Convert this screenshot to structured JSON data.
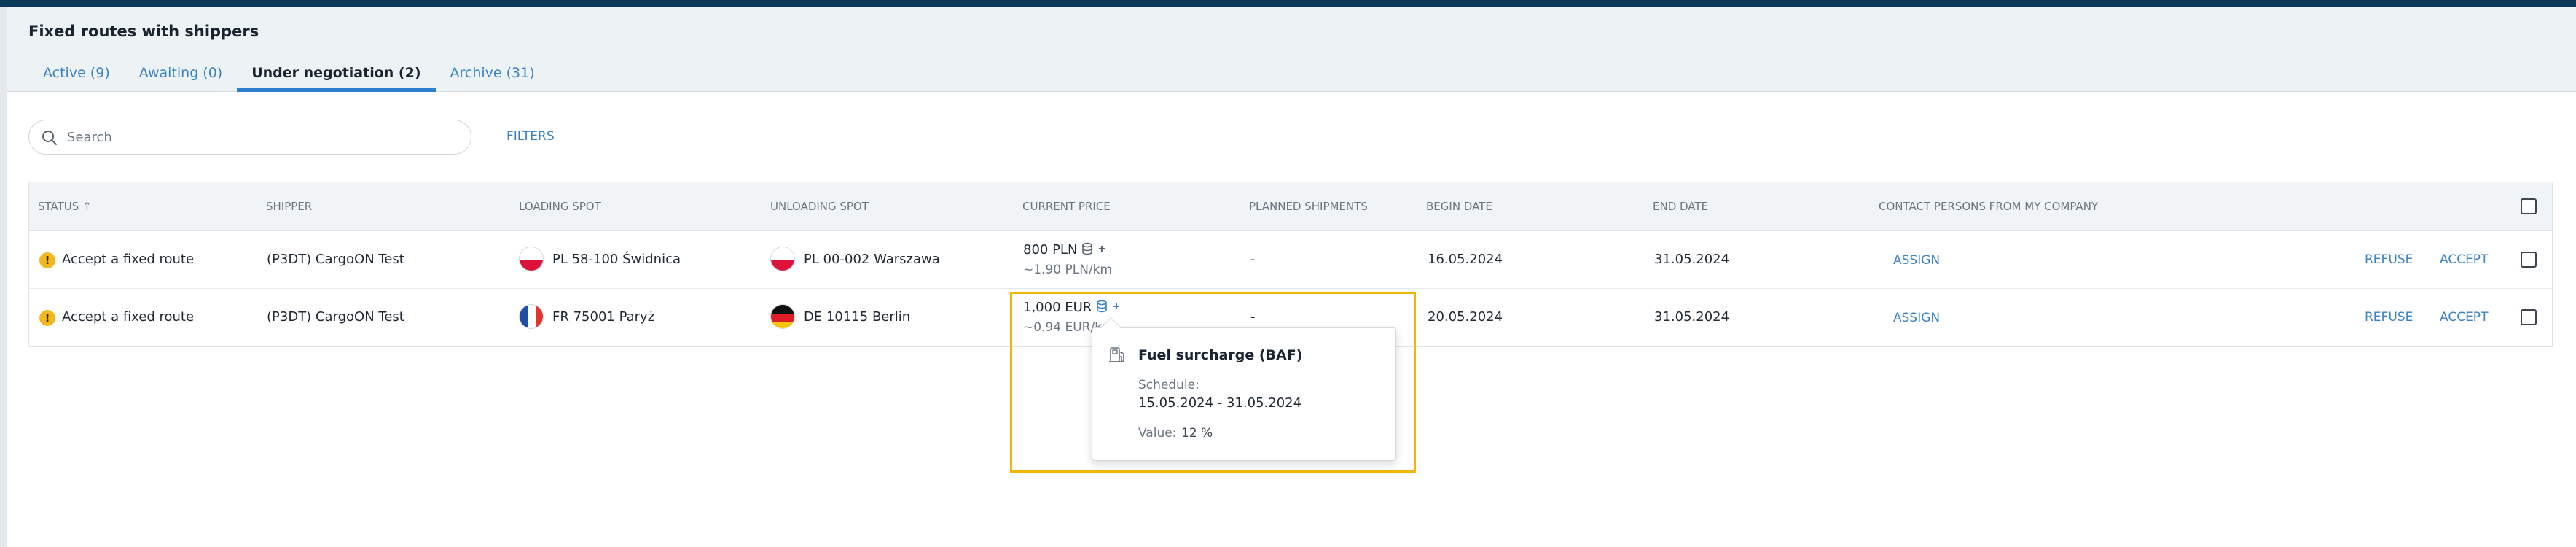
{
  "page": {
    "title": "Fixed routes with shippers"
  },
  "tabs": [
    {
      "label": "Active (9)",
      "active": false
    },
    {
      "label": "Awaiting (0)",
      "active": false
    },
    {
      "label": "Under negotiation (2)",
      "active": true
    },
    {
      "label": "Archive (31)",
      "active": false
    }
  ],
  "search": {
    "placeholder": "Search",
    "value": ""
  },
  "filters_label": "FILTERS",
  "table": {
    "headers": {
      "status": "STATUS",
      "shipper": "SHIPPER",
      "loading": "LOADING SPOT",
      "unloading": "UNLOADING SPOT",
      "price": "CURRENT PRICE",
      "planned": "PLANNED SHIPMENTS",
      "begin": "BEGIN DATE",
      "end": "END DATE",
      "contacts": "CONTACT PERSONS FROM MY COMPANY"
    },
    "rows": [
      {
        "status": "Accept a fixed route",
        "shipper": "(P3DT) CargoON Test",
        "loading_flag": "pl",
        "loading": "PL 58-100 Świdnica",
        "unloading_flag": "pl",
        "unloading": "PL 00-002 Warszawa",
        "price": "800 PLN",
        "price_sub": "~1.90 PLN/km",
        "planned": "-",
        "begin": "16.05.2024",
        "end": "31.05.2024",
        "assign": "ASSIGN",
        "refuse": "REFUSE",
        "accept": "ACCEPT"
      },
      {
        "status": "Accept a fixed route",
        "shipper": "(P3DT) CargoON Test",
        "loading_flag": "fr",
        "loading": "FR 75001 Paryż",
        "unloading_flag": "de",
        "unloading": "DE 10115 Berlin",
        "price": "1,000 EUR",
        "price_sub": "~0.94 EUR/km",
        "planned": "-",
        "begin": "20.05.2024",
        "end": "31.05.2024",
        "assign": "ASSIGN",
        "refuse": "REFUSE",
        "accept": "ACCEPT"
      }
    ]
  },
  "tooltip": {
    "title": "Fuel surcharge (BAF)",
    "schedule_label": "Schedule:",
    "schedule": "15.05.2024 - 31.05.2024",
    "value_label": "Value:",
    "value": "12 %"
  },
  "icons": [
    "search-icon",
    "sort-up-icon",
    "warning-icon",
    "surcharge-icon",
    "fuel-pump-icon"
  ],
  "colors": {
    "accent": "#3b82c4",
    "warning": "#f3b81e",
    "highlight": "#f2b705",
    "topbar": "#0b3a5a"
  }
}
